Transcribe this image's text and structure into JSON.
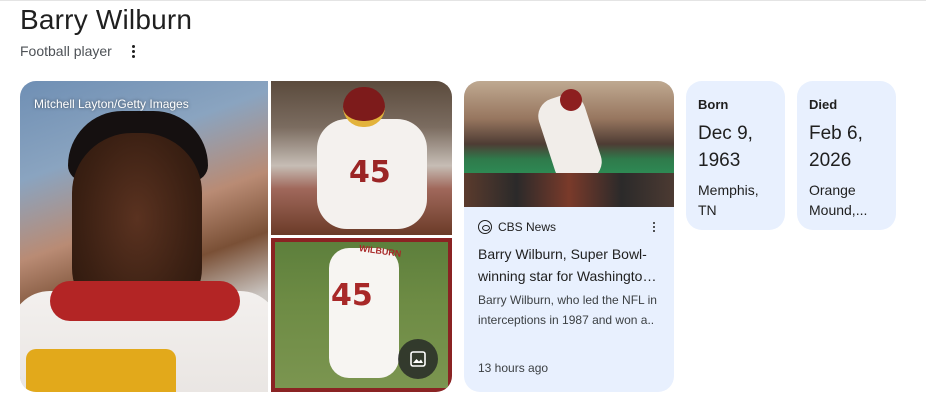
{
  "header": {
    "title": "Barry Wilburn",
    "subtitle": "Football player"
  },
  "images": {
    "credit": "Mitchell Layton/Getty Images",
    "main_jersey_number": "45",
    "bottom_jersey_name": "WILBURN",
    "image_icon": "image-icon"
  },
  "news": {
    "source": "CBS News",
    "headline": "Barry Wilburn, Super Bowl-winning star for Washingto…",
    "snippet": "Barry Wilburn, who led the NFL in interceptions in 1987 and won a..",
    "time": "13 hours ago"
  },
  "facts": {
    "born": {
      "label": "Born",
      "date": "Dec 9, 1963",
      "place": "Memphis, TN"
    },
    "died": {
      "label": "Died",
      "date": "Feb 6, 2026",
      "place": "Orange Mound,..."
    }
  },
  "colors": {
    "card_bg": "#e8f0fe",
    "text": "#1f1f1f",
    "subtext": "#4d5156"
  }
}
